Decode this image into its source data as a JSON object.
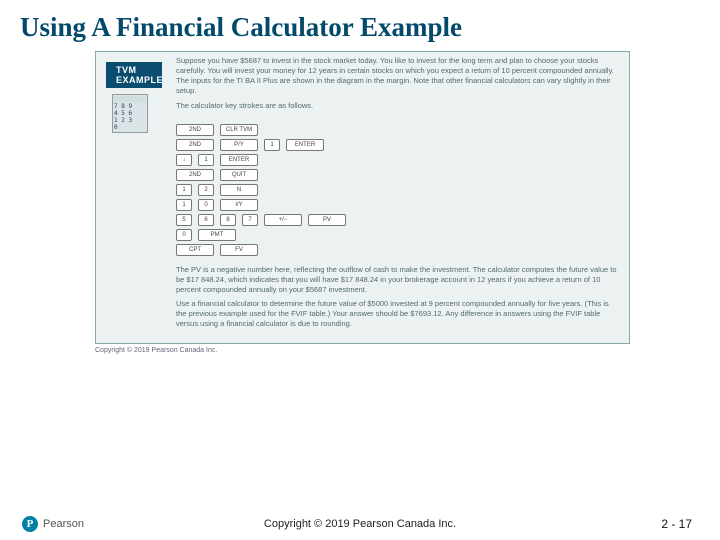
{
  "title": "Using A Financial Calculator Example",
  "tvm_label": "TVM EXAMPLE",
  "calc": {
    "r1": "7 8 9",
    "r2": "4 5 6",
    "r3": "1 2 3",
    "r4": "0"
  },
  "intro": "Suppose you have $5687 to invest in the stock market today. You like to invest for the long term and plan to choose your stocks carefully. You will invest your money for 12 years in certain stocks on which you expect a return of 10 percent compounded annually. The inputs for the TI BA II Plus are shown in the diagram in the margin. Note that other financial calculators can vary slightly in their setup.",
  "lead": "The calculator key strokes are as follows.",
  "rows": [
    [
      {
        "t": "2ND",
        "w": "wide"
      },
      {
        "t": "CLR TVM",
        "w": "wide"
      }
    ],
    [
      {
        "t": "2ND",
        "w": "wide"
      },
      {
        "t": "P/Y",
        "w": "wide"
      },
      {
        "t": "1",
        "w": "sm"
      },
      {
        "t": "ENTER",
        "w": "wide"
      }
    ],
    [
      {
        "t": "↓",
        "w": "sm"
      },
      {
        "t": "1",
        "w": "sm"
      },
      {
        "t": "ENTER",
        "w": "wide"
      }
    ],
    [
      {
        "t": "2ND",
        "w": "wide"
      },
      {
        "t": "QUIT",
        "w": "wide"
      }
    ],
    [
      {
        "t": "1",
        "w": "sm"
      },
      {
        "t": "2",
        "w": "sm"
      },
      {
        "t": "N",
        "w": "wide"
      }
    ],
    [
      {
        "t": "1",
        "w": "sm"
      },
      {
        "t": "0",
        "w": "sm"
      },
      {
        "t": "I/Y",
        "w": "wide"
      }
    ],
    [
      {
        "t": "5",
        "w": "sm"
      },
      {
        "t": "6",
        "w": "sm"
      },
      {
        "t": "8",
        "w": "sm"
      },
      {
        "t": "7",
        "w": "sm"
      },
      {
        "t": "+/−",
        "w": "wide"
      },
      {
        "t": "PV",
        "w": "wide"
      }
    ],
    [
      {
        "t": "0",
        "w": "sm"
      },
      {
        "t": "PMT",
        "w": "wide"
      }
    ],
    [
      {
        "t": "CPT",
        "w": "wide"
      },
      {
        "t": "FV",
        "w": "wide"
      }
    ]
  ],
  "explain1": "The PV is a negative number here, reflecting the outflow of cash to make the investment. The calculator computes the future value to be $17 848.24, which indicates that you will have $17 848.24 in your brokerage account in 12 years if you achieve a return of 10 percent compounded annually on your $5687 investment.",
  "explain2": "Use a financial calculator to determine the future value of $5000 invested at 9 percent compounded annually for five years. (This is the previous example used for the FVIF table.) Your answer should be $7693.12. Any difference in answers using the FVIF table versus using a financial calculator is due to rounding.",
  "inner_copy": "Copyright © 2019 Pearson Canada Inc.",
  "footer": {
    "brand": "Pearson",
    "logo": "P",
    "center": "Copyright © 2019 Pearson Canada Inc.",
    "right": "2 - 17"
  }
}
